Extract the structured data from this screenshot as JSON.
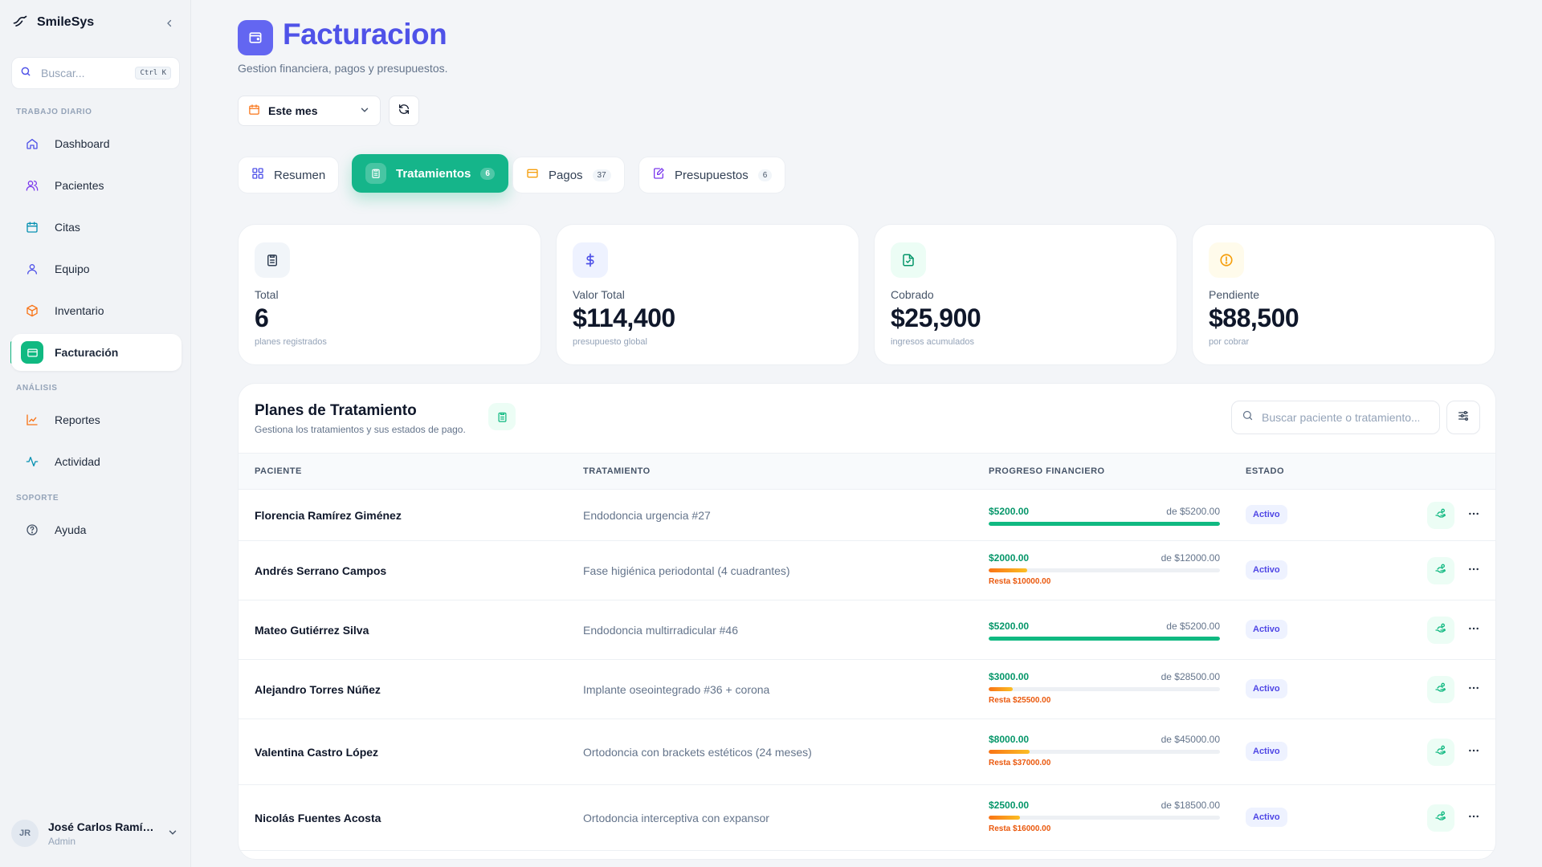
{
  "app": {
    "name": "SmileSys"
  },
  "sidebar": {
    "search_placeholder": "Buscar...",
    "shortcut": "Ctrl K",
    "sections": {
      "daily": "TRABAJO DIARIO",
      "analysis": "ANÁLISIS",
      "support": "SOPORTE"
    },
    "items": [
      {
        "label": "Dashboard",
        "icon": "home-icon"
      },
      {
        "label": "Pacientes",
        "icon": "users-icon"
      },
      {
        "label": "Citas",
        "icon": "calendar-icon"
      },
      {
        "label": "Equipo",
        "icon": "user-icon"
      },
      {
        "label": "Inventario",
        "icon": "box-icon"
      },
      {
        "label": "Facturación",
        "icon": "wallet-icon",
        "active": true
      },
      {
        "label": "Reportes",
        "icon": "chart-icon"
      },
      {
        "label": "Actividad",
        "icon": "activity-icon"
      },
      {
        "label": "Ayuda",
        "icon": "help-icon"
      }
    ],
    "user": {
      "initials": "JR",
      "name": "José Carlos Ramírez",
      "role": "Admin"
    }
  },
  "header": {
    "title": "Facturacion",
    "subtitle": "Gestion financiera, pagos y presupuestos.",
    "period": "Este mes"
  },
  "tabs": [
    {
      "label": "Resumen",
      "count": null
    },
    {
      "label": "Tratamientos",
      "count": "6",
      "active": true
    },
    {
      "label": "Pagos",
      "count": "37"
    },
    {
      "label": "Presupuestos",
      "count": "6"
    }
  ],
  "stats": [
    {
      "label": "Total",
      "value": "6",
      "sub": "planes registrados"
    },
    {
      "label": "Valor Total",
      "value": "$114,400",
      "sub": "presupuesto global"
    },
    {
      "label": "Cobrado",
      "value": "$25,900",
      "sub": "ingresos acumulados"
    },
    {
      "label": "Pendiente",
      "value": "$88,500",
      "sub": "por cobrar"
    }
  ],
  "table": {
    "title": "Planes de Tratamiento",
    "subtitle": "Gestiona los tratamientos y sus estados de pago.",
    "search_placeholder": "Buscar paciente o tratamiento...",
    "columns": [
      "PACIENTE",
      "TRATAMIENTO",
      "PROGRESO FINANCIERO",
      "ESTADO"
    ],
    "rows": [
      {
        "patient": "Florencia Ramírez Giménez",
        "treatment": "Endodoncia urgencia #27",
        "paid": "$5200.00",
        "total": "de $5200.00",
        "progress": 1.0,
        "rest": "",
        "status": "Activo"
      },
      {
        "patient": "Andrés Serrano Campos",
        "treatment": "Fase higiénica periodontal (4 cuadrantes)",
        "paid": "$2000.00",
        "total": "de $12000.00",
        "progress": 0.1667,
        "rest": "Resta $10000.00",
        "status": "Activo"
      },
      {
        "patient": "Mateo Gutiérrez Silva",
        "treatment": "Endodoncia multirradicular #46",
        "paid": "$5200.00",
        "total": "de $5200.00",
        "progress": 1.0,
        "rest": "",
        "status": "Activo"
      },
      {
        "patient": "Alejandro Torres Núñez",
        "treatment": "Implante oseointegrado #36 + corona",
        "paid": "$3000.00",
        "total": "de $28500.00",
        "progress": 0.1053,
        "rest": "Resta $25500.00",
        "status": "Activo"
      },
      {
        "patient": "Valentina Castro López",
        "treatment": "Ortodoncia con brackets estéticos (24 meses)",
        "paid": "$8000.00",
        "total": "de $45000.00",
        "progress": 0.1778,
        "rest": "Resta $37000.00",
        "status": "Activo"
      },
      {
        "patient": "Nicolás Fuentes Acosta",
        "treatment": "Ortodoncia interceptiva con expansor",
        "paid": "$2500.00",
        "total": "de $18500.00",
        "progress": 0.1351,
        "rest": "Resta $16000.00",
        "status": "Activo"
      }
    ]
  },
  "colors": {
    "accent": "#15b58a",
    "brand": "#4f52e8",
    "warning": "#f97316"
  }
}
